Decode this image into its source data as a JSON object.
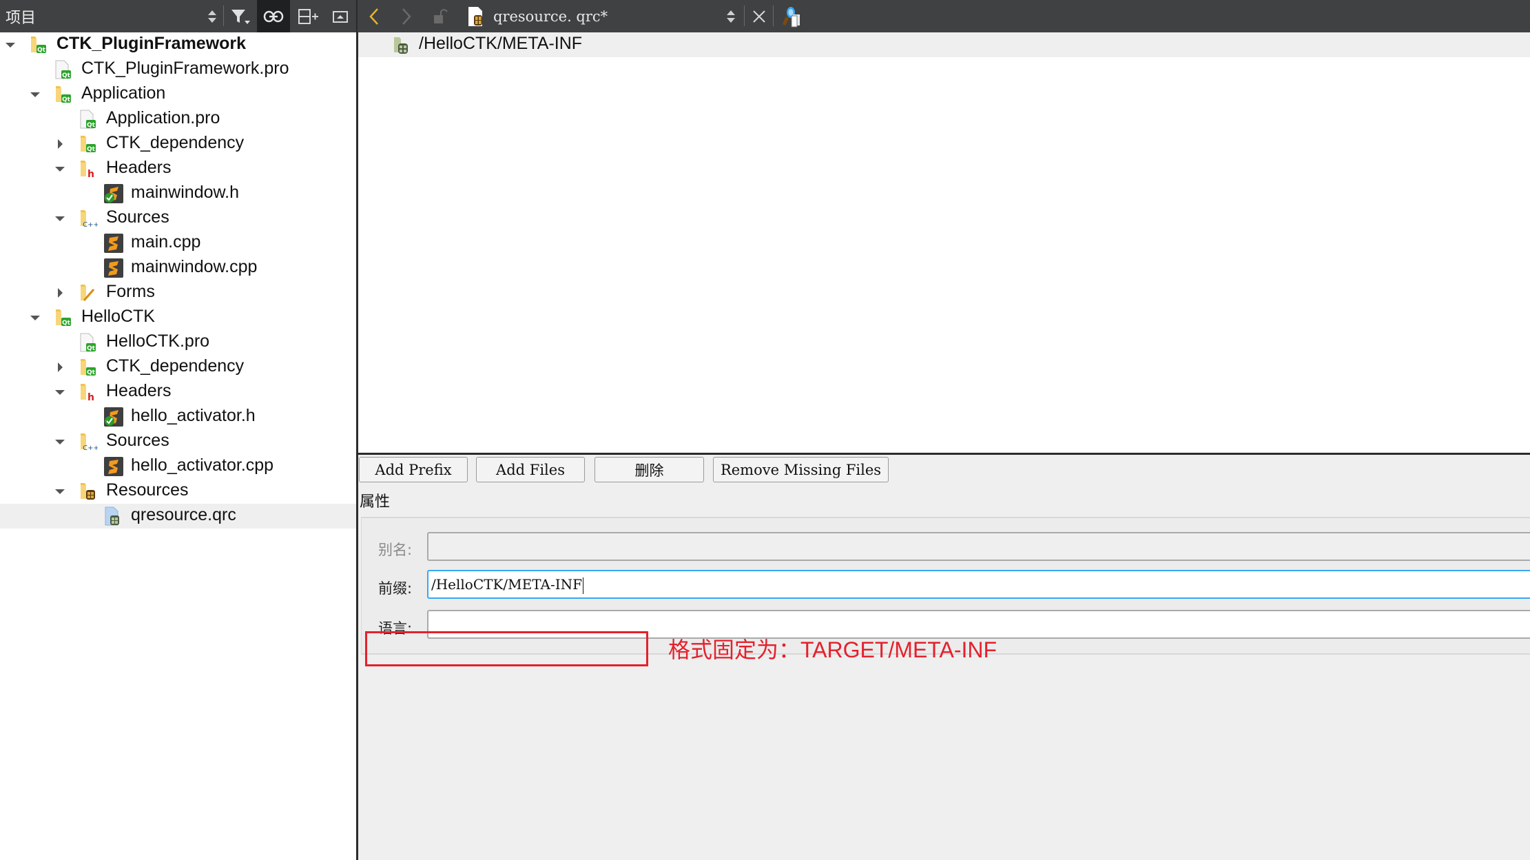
{
  "toolbar": {
    "panel_title": "项目",
    "icons": {
      "sort": "up-down-arrows-icon",
      "filter": "filter-icon",
      "link": "link-icon",
      "split": "split-add-icon",
      "close_panel": "hide-panel-icon",
      "back": "chevron-left-icon",
      "forward": "chevron-right-icon",
      "lock": "unlock-icon",
      "file": "resource-file-icon",
      "close": "close-icon",
      "locator": "search-docs-icon"
    },
    "open_file": "qresource. qrc*"
  },
  "tree": [
    {
      "label": "CTK_PluginFramework",
      "depth": 0,
      "expand": "expanded",
      "icon": "qt-project-folder",
      "bold": true
    },
    {
      "label": "CTK_PluginFramework.pro",
      "depth": 1,
      "expand": "none",
      "icon": "qt-pro-file"
    },
    {
      "label": "Application",
      "depth": 1,
      "expand": "expanded",
      "icon": "qt-project-folder"
    },
    {
      "label": "Application.pro",
      "depth": 2,
      "expand": "none",
      "icon": "qt-pro-file"
    },
    {
      "label": "CTK_dependency",
      "depth": 2,
      "expand": "collapsed",
      "icon": "qt-project-folder"
    },
    {
      "label": "Headers",
      "depth": 2,
      "expand": "expanded",
      "icon": "headers-folder"
    },
    {
      "label": "mainwindow.h",
      "depth": 3,
      "expand": "none",
      "icon": "header-file"
    },
    {
      "label": "Sources",
      "depth": 2,
      "expand": "expanded",
      "icon": "sources-folder"
    },
    {
      "label": "main.cpp",
      "depth": 3,
      "expand": "none",
      "icon": "cpp-file"
    },
    {
      "label": "mainwindow.cpp",
      "depth": 3,
      "expand": "none",
      "icon": "cpp-file"
    },
    {
      "label": "Forms",
      "depth": 2,
      "expand": "collapsed",
      "icon": "forms-folder"
    },
    {
      "label": "HelloCTK",
      "depth": 1,
      "expand": "expanded",
      "icon": "qt-project-folder"
    },
    {
      "label": "HelloCTK.pro",
      "depth": 2,
      "expand": "none",
      "icon": "qt-pro-file"
    },
    {
      "label": "CTK_dependency",
      "depth": 2,
      "expand": "collapsed",
      "icon": "qt-project-folder"
    },
    {
      "label": "Headers",
      "depth": 2,
      "expand": "expanded",
      "icon": "headers-folder"
    },
    {
      "label": "hello_activator.h",
      "depth": 3,
      "expand": "none",
      "icon": "header-file"
    },
    {
      "label": "Sources",
      "depth": 2,
      "expand": "expanded",
      "icon": "sources-folder"
    },
    {
      "label": "hello_activator.cpp",
      "depth": 3,
      "expand": "none",
      "icon": "cpp-file"
    },
    {
      "label": "Resources",
      "depth": 2,
      "expand": "expanded",
      "icon": "resources-folder"
    },
    {
      "label": "qresource.qrc",
      "depth": 3,
      "expand": "none",
      "icon": "qrc-file",
      "selected": true
    }
  ],
  "editor": {
    "prefix_item": "/HelloCTK/META-INF",
    "buttons": {
      "add_prefix": "Add Prefix",
      "add_files": "Add Files",
      "remove": "删除",
      "remove_missing": "Remove Missing Files"
    },
    "properties_title": "属性",
    "fields": {
      "alias_label": "别名:",
      "alias_value": "",
      "prefix_label": "前缀:",
      "prefix_value": "/HelloCTK/META-INF",
      "language_label": "语言:",
      "language_value": ""
    },
    "annotation": "格式固定为：TARGET/META-INF"
  },
  "colors": {
    "toolbar_bg": "#404142",
    "annotation_red": "#e5202c",
    "focus_blue": "#3aa6f2",
    "qt_green": "#2aa42a",
    "back_arrow": "#e8b325"
  }
}
